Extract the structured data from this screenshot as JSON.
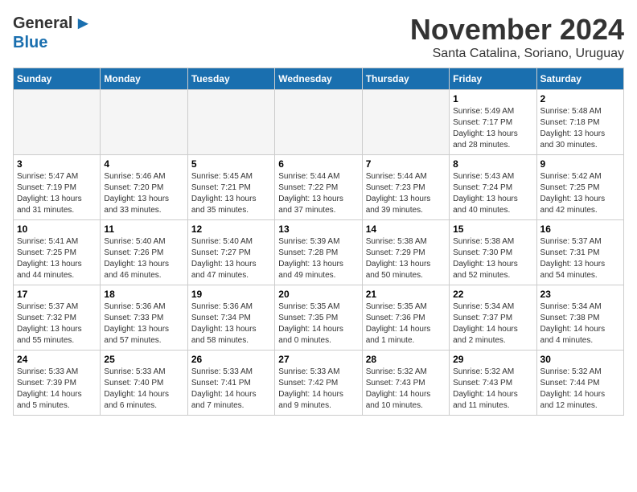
{
  "logo": {
    "general": "General",
    "blue": "Blue",
    "arrow": "▶"
  },
  "title": "November 2024",
  "subtitle": "Santa Catalina, Soriano, Uruguay",
  "days_header": [
    "Sunday",
    "Monday",
    "Tuesday",
    "Wednesday",
    "Thursday",
    "Friday",
    "Saturday"
  ],
  "weeks": [
    [
      {
        "day": "",
        "info": ""
      },
      {
        "day": "",
        "info": ""
      },
      {
        "day": "",
        "info": ""
      },
      {
        "day": "",
        "info": ""
      },
      {
        "day": "",
        "info": ""
      },
      {
        "day": "1",
        "info": "Sunrise: 5:49 AM\nSunset: 7:17 PM\nDaylight: 13 hours\nand 28 minutes."
      },
      {
        "day": "2",
        "info": "Sunrise: 5:48 AM\nSunset: 7:18 PM\nDaylight: 13 hours\nand 30 minutes."
      }
    ],
    [
      {
        "day": "3",
        "info": "Sunrise: 5:47 AM\nSunset: 7:19 PM\nDaylight: 13 hours\nand 31 minutes."
      },
      {
        "day": "4",
        "info": "Sunrise: 5:46 AM\nSunset: 7:20 PM\nDaylight: 13 hours\nand 33 minutes."
      },
      {
        "day": "5",
        "info": "Sunrise: 5:45 AM\nSunset: 7:21 PM\nDaylight: 13 hours\nand 35 minutes."
      },
      {
        "day": "6",
        "info": "Sunrise: 5:44 AM\nSunset: 7:22 PM\nDaylight: 13 hours\nand 37 minutes."
      },
      {
        "day": "7",
        "info": "Sunrise: 5:44 AM\nSunset: 7:23 PM\nDaylight: 13 hours\nand 39 minutes."
      },
      {
        "day": "8",
        "info": "Sunrise: 5:43 AM\nSunset: 7:24 PM\nDaylight: 13 hours\nand 40 minutes."
      },
      {
        "day": "9",
        "info": "Sunrise: 5:42 AM\nSunset: 7:25 PM\nDaylight: 13 hours\nand 42 minutes."
      }
    ],
    [
      {
        "day": "10",
        "info": "Sunrise: 5:41 AM\nSunset: 7:25 PM\nDaylight: 13 hours\nand 44 minutes."
      },
      {
        "day": "11",
        "info": "Sunrise: 5:40 AM\nSunset: 7:26 PM\nDaylight: 13 hours\nand 46 minutes."
      },
      {
        "day": "12",
        "info": "Sunrise: 5:40 AM\nSunset: 7:27 PM\nDaylight: 13 hours\nand 47 minutes."
      },
      {
        "day": "13",
        "info": "Sunrise: 5:39 AM\nSunset: 7:28 PM\nDaylight: 13 hours\nand 49 minutes."
      },
      {
        "day": "14",
        "info": "Sunrise: 5:38 AM\nSunset: 7:29 PM\nDaylight: 13 hours\nand 50 minutes."
      },
      {
        "day": "15",
        "info": "Sunrise: 5:38 AM\nSunset: 7:30 PM\nDaylight: 13 hours\nand 52 minutes."
      },
      {
        "day": "16",
        "info": "Sunrise: 5:37 AM\nSunset: 7:31 PM\nDaylight: 13 hours\nand 54 minutes."
      }
    ],
    [
      {
        "day": "17",
        "info": "Sunrise: 5:37 AM\nSunset: 7:32 PM\nDaylight: 13 hours\nand 55 minutes."
      },
      {
        "day": "18",
        "info": "Sunrise: 5:36 AM\nSunset: 7:33 PM\nDaylight: 13 hours\nand 57 minutes."
      },
      {
        "day": "19",
        "info": "Sunrise: 5:36 AM\nSunset: 7:34 PM\nDaylight: 13 hours\nand 58 minutes."
      },
      {
        "day": "20",
        "info": "Sunrise: 5:35 AM\nSunset: 7:35 PM\nDaylight: 14 hours\nand 0 minutes."
      },
      {
        "day": "21",
        "info": "Sunrise: 5:35 AM\nSunset: 7:36 PM\nDaylight: 14 hours\nand 1 minute."
      },
      {
        "day": "22",
        "info": "Sunrise: 5:34 AM\nSunset: 7:37 PM\nDaylight: 14 hours\nand 2 minutes."
      },
      {
        "day": "23",
        "info": "Sunrise: 5:34 AM\nSunset: 7:38 PM\nDaylight: 14 hours\nand 4 minutes."
      }
    ],
    [
      {
        "day": "24",
        "info": "Sunrise: 5:33 AM\nSunset: 7:39 PM\nDaylight: 14 hours\nand 5 minutes."
      },
      {
        "day": "25",
        "info": "Sunrise: 5:33 AM\nSunset: 7:40 PM\nDaylight: 14 hours\nand 6 minutes."
      },
      {
        "day": "26",
        "info": "Sunrise: 5:33 AM\nSunset: 7:41 PM\nDaylight: 14 hours\nand 7 minutes."
      },
      {
        "day": "27",
        "info": "Sunrise: 5:33 AM\nSunset: 7:42 PM\nDaylight: 14 hours\nand 9 minutes."
      },
      {
        "day": "28",
        "info": "Sunrise: 5:32 AM\nSunset: 7:43 PM\nDaylight: 14 hours\nand 10 minutes."
      },
      {
        "day": "29",
        "info": "Sunrise: 5:32 AM\nSunset: 7:43 PM\nDaylight: 14 hours\nand 11 minutes."
      },
      {
        "day": "30",
        "info": "Sunrise: 5:32 AM\nSunset: 7:44 PM\nDaylight: 14 hours\nand 12 minutes."
      }
    ]
  ]
}
